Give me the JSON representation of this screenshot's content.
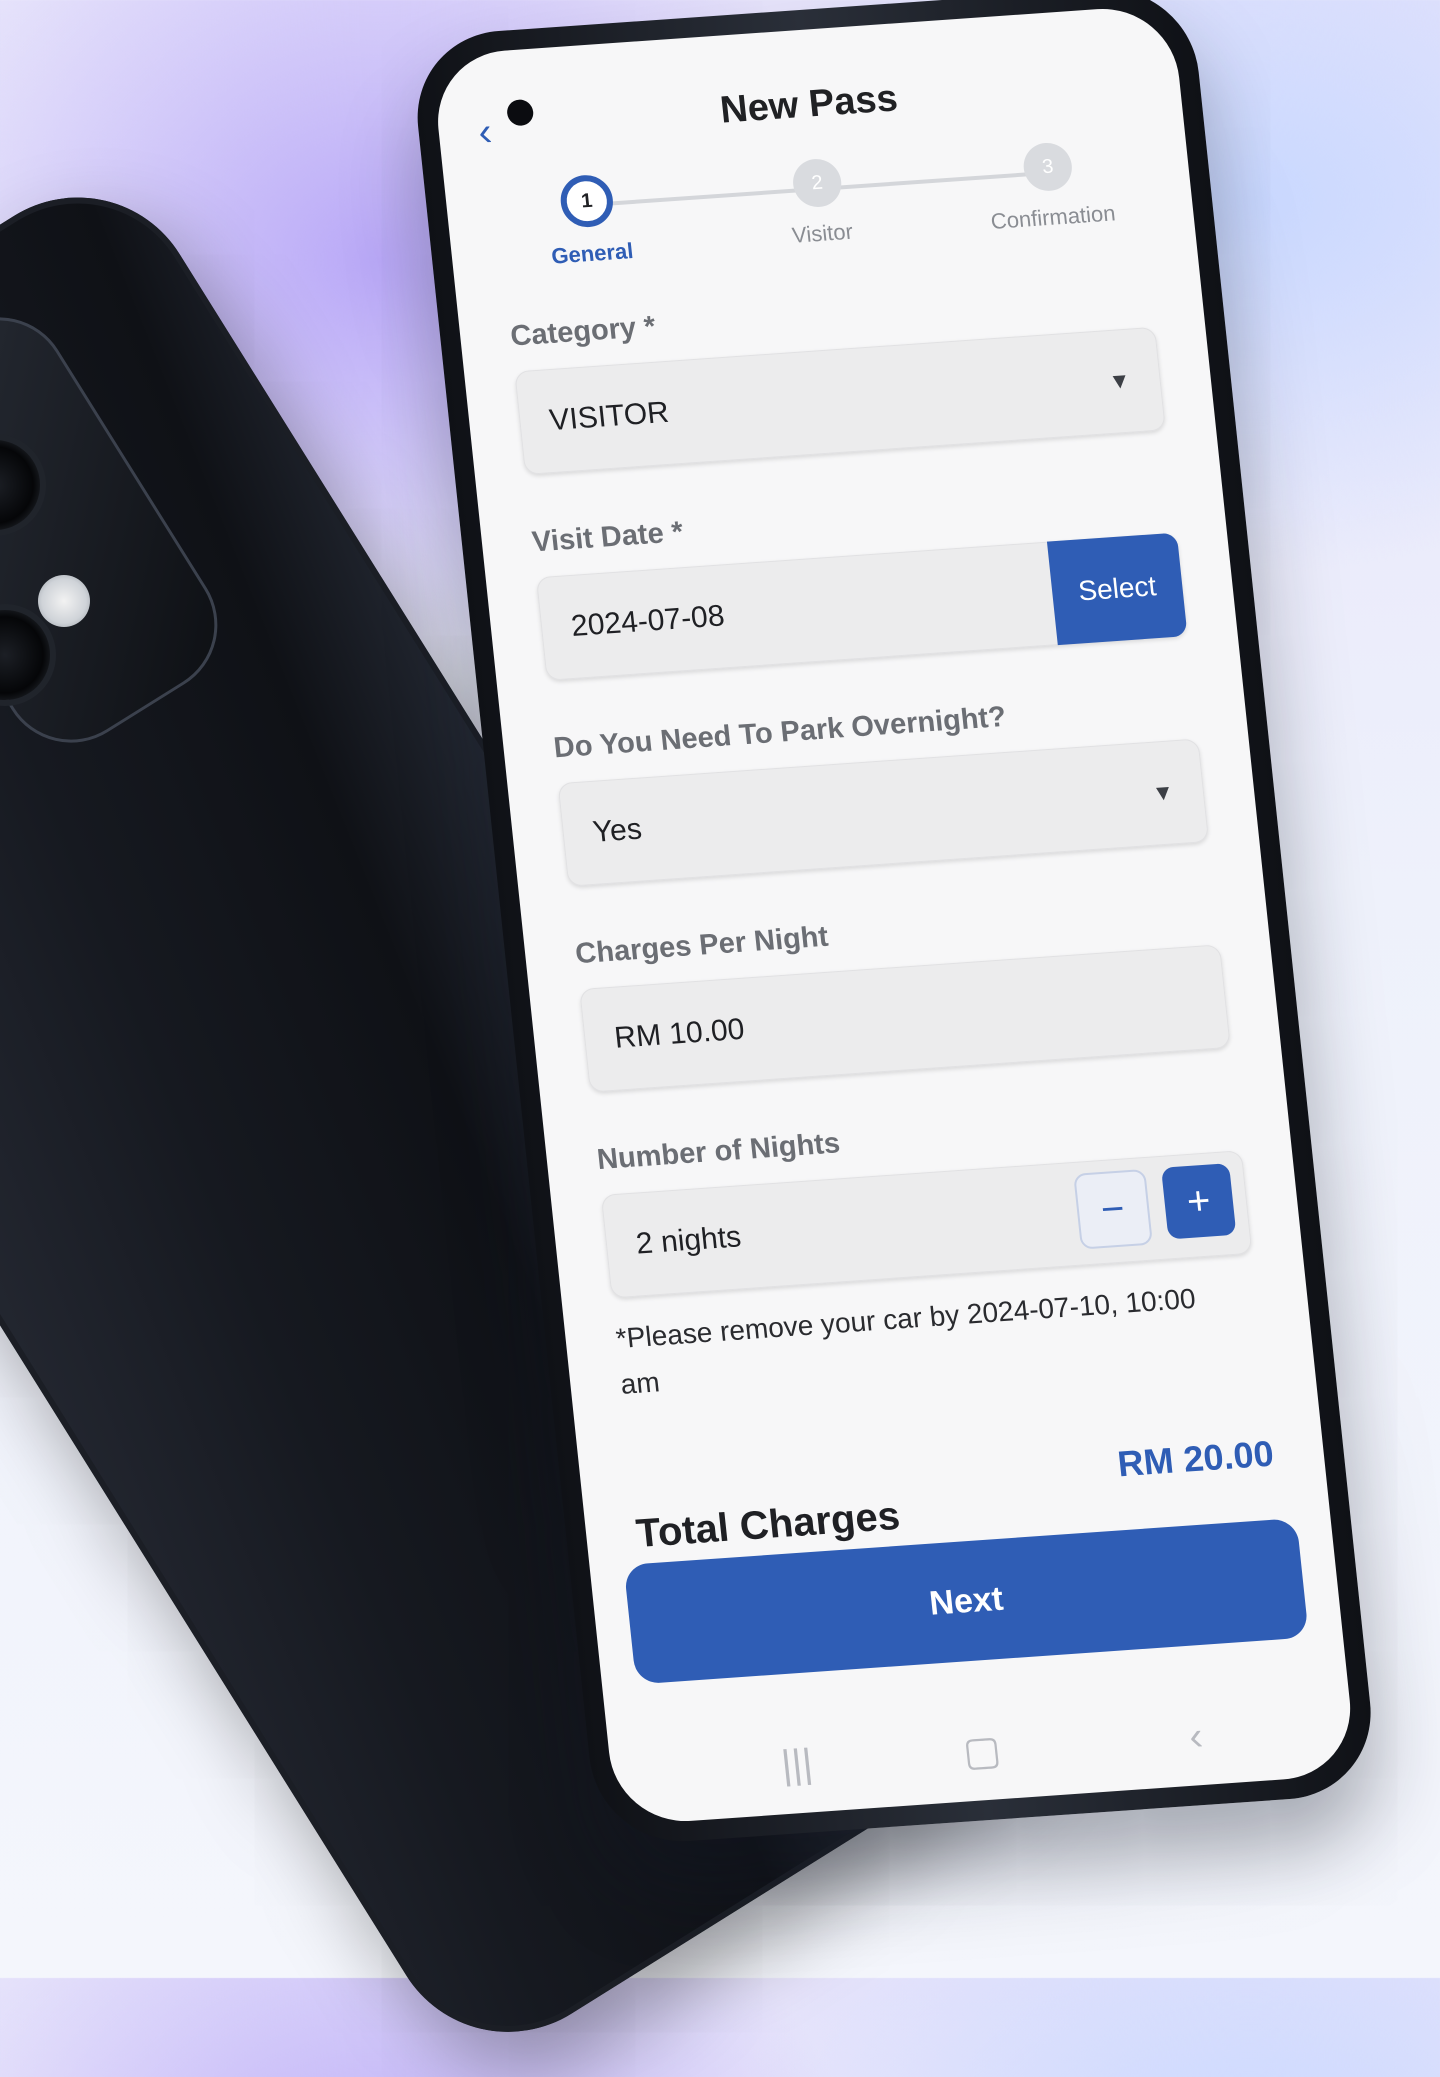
{
  "app": {
    "title": "New Pass"
  },
  "stepper": [
    {
      "num": "1",
      "label": "General",
      "active": true
    },
    {
      "num": "2",
      "label": "Visitor",
      "active": false
    },
    {
      "num": "3",
      "label": "Confirmation",
      "active": false
    }
  ],
  "form": {
    "category": {
      "label": "Category *",
      "value": "VISITOR"
    },
    "visit_date": {
      "label": "Visit Date *",
      "value": "2024-07-08",
      "button": "Select"
    },
    "overnight": {
      "label": "Do You Need To Park Overnight?",
      "value": "Yes"
    },
    "charges": {
      "label": "Charges Per Night",
      "value": "RM 10.00"
    },
    "nights": {
      "label": "Number of Nights",
      "value": "2 nights",
      "minus": "−",
      "plus": "+"
    },
    "note": "*Please remove your car by 2024-07-10, 10:00 am"
  },
  "total": {
    "label": "Total Charges",
    "value": "RM 20.00"
  },
  "actions": {
    "next": "Next"
  },
  "icons": {
    "back": "chevron-left-icon",
    "dropdown": "caret-down-icon"
  },
  "colors": {
    "accent": "#2f5db5"
  }
}
